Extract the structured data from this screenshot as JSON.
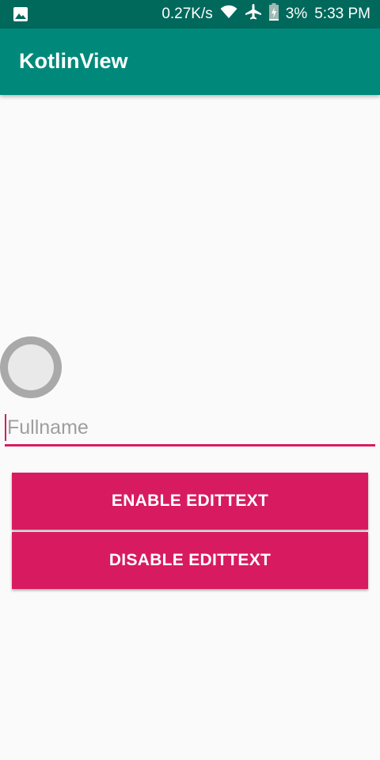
{
  "status_bar": {
    "network_speed": "0.27K/s",
    "battery_percent": "3%",
    "time": "5:33 PM",
    "icons": [
      "image-icon",
      "wifi-icon",
      "airplane-icon",
      "battery-charging-icon"
    ]
  },
  "app_bar": {
    "title": "KotlinView"
  },
  "form": {
    "fullname_placeholder": "Fullname",
    "fullname_value": ""
  },
  "buttons": {
    "enable_label": "ENABLE EDITTEXT",
    "disable_label": "DISABLE EDITTEXT"
  },
  "colors": {
    "status_bar": "#00695c",
    "app_bar": "#00897b",
    "accent": "#d81b60",
    "background": "#fafafa"
  }
}
